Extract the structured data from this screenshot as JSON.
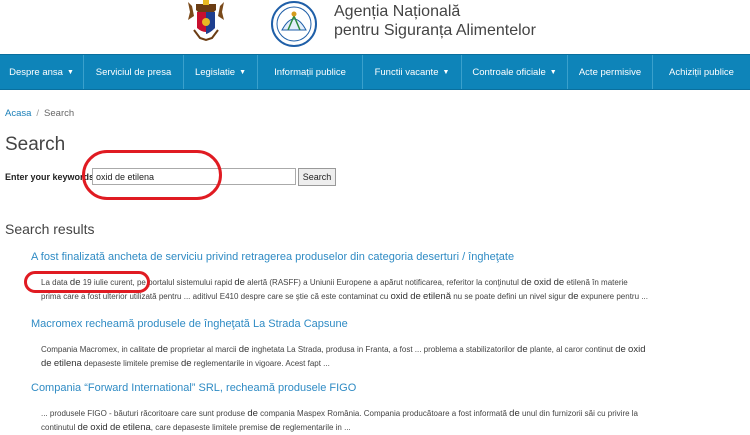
{
  "header": {
    "agency_line1": "Agenția Națională",
    "agency_line2": "pentru Siguranța Alimentelor",
    "logo_text": "ANSA"
  },
  "navbar": {
    "items": [
      {
        "label": "Despre ansa",
        "dropdown": true
      },
      {
        "label": "Serviciul de presa",
        "dropdown": false
      },
      {
        "label": "Legislatie",
        "dropdown": true
      },
      {
        "label": "Informații publice",
        "dropdown": false
      },
      {
        "label": "Functii vacante",
        "dropdown": true
      },
      {
        "label": "Controale oficiale",
        "dropdown": true
      },
      {
        "label": "Acte permisive",
        "dropdown": false
      },
      {
        "label": "Achiziții publice",
        "dropdown": false
      }
    ],
    "caret": "▼"
  },
  "breadcrumb": {
    "home": "Acasa",
    "separator": "/",
    "current": "Search"
  },
  "page_title": "Search",
  "search": {
    "label": "Enter your keywords",
    "value": "oxid de etilena",
    "button": "Search"
  },
  "results_title": "Search results",
  "results": [
    {
      "title": "A fost finalizată ancheta de serviciu privind retragerea produselor din categoria deserturi / îngheţate",
      "line1": [
        {
          "t": "La data "
        },
        {
          "t": "de",
          "hl": true
        },
        {
          "t": " 19 iulie curent, pe portalul sistemului rapid "
        },
        {
          "t": "de",
          "hl": true
        },
        {
          "t": " alertă (RASFF) a  Uniunii Europene a apărut notificarea, referitor la conţinutul "
        },
        {
          "t": "de",
          "hl": true
        },
        {
          "t": " "
        },
        {
          "t": "oxid",
          "hl": true
        },
        {
          "t": " "
        },
        {
          "t": "de",
          "hl": true
        },
        {
          "t": " etilenă în materie"
        }
      ],
      "line2": [
        {
          "t": "prima care a fost ulterior utilizată pentru ... aditivul E410 despre care se ştie că este contaminat cu "
        },
        {
          "t": "oxid",
          "hl": true
        },
        {
          "t": " "
        },
        {
          "t": "de",
          "hl": true
        },
        {
          "t": " "
        },
        {
          "t": "etilenă",
          "hl": true
        },
        {
          "t": " nu se poate defini un nivel sigur "
        },
        {
          "t": "de",
          "hl": true
        },
        {
          "t": " expunere pentru ..."
        }
      ]
    },
    {
      "title": "Macromex recheamă produsele de îngheţată La Strada Capsune",
      "line1": [
        {
          "t": "Compania Macromex, in calitate "
        },
        {
          "t": "de",
          "hl": true
        },
        {
          "t": " proprietar al marcii "
        },
        {
          "t": "de",
          "hl": true
        },
        {
          "t": " inghetata La Strada, produsa in Franta, a fost ... problema a stabilizatorilor "
        },
        {
          "t": "de",
          "hl": true
        },
        {
          "t": " plante, al caror continut "
        },
        {
          "t": "de",
          "hl": true
        },
        {
          "t": " "
        },
        {
          "t": "oxid",
          "hl": true
        }
      ],
      "line2": [
        {
          "t": "de",
          "hl": true
        },
        {
          "t": " "
        },
        {
          "t": "etilena",
          "hl": true
        },
        {
          "t": " depaseste limitele premise "
        },
        {
          "t": "de",
          "hl": true
        },
        {
          "t": " reglementarile in vigoare.  Acest fapt ..."
        }
      ]
    },
    {
      "title": "Compania “Forward International” SRL, recheamă produsele FIGO",
      "line1": [
        {
          "t": "... produsele FIGO - băuturi răcoritoare care sunt produse "
        },
        {
          "t": "de",
          "hl": true
        },
        {
          "t": " compania Maspex România. Compania producătoare a fost informată "
        },
        {
          "t": "de",
          "hl": true
        },
        {
          "t": " unul din furnizorii săi cu privire la"
        }
      ],
      "line2": [
        {
          "t": "continutul "
        },
        {
          "t": "de",
          "hl": true
        },
        {
          "t": " "
        },
        {
          "t": "oxid",
          "hl": true
        },
        {
          "t": " "
        },
        {
          "t": "de",
          "hl": true
        },
        {
          "t": " "
        },
        {
          "t": "etilena",
          "hl": true
        },
        {
          "t": ", care depaseste limitele premise "
        },
        {
          "t": "de",
          "hl": true
        },
        {
          "t": " reglementarile in ..."
        }
      ]
    }
  ],
  "colors": {
    "nav_bg": "#0e84b9",
    "link": "#2f8bc4",
    "annotation": "#e01b22"
  }
}
